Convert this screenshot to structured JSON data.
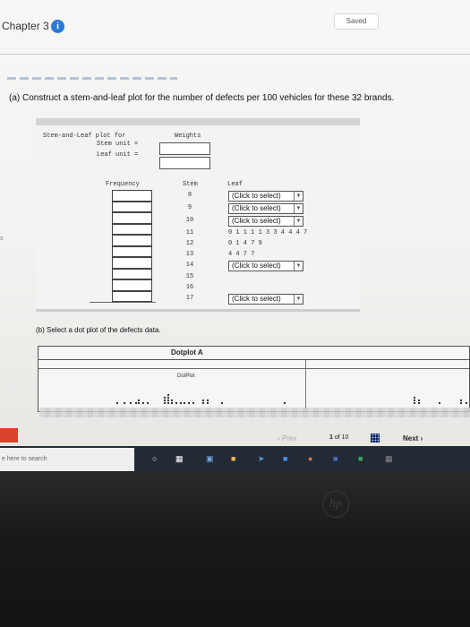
{
  "header": {
    "chapter_label": "Chapter 3",
    "info_glyph": "i",
    "saved_label": "Saved"
  },
  "part_a": {
    "prompt": "(a) Construct a stem-and-leaf plot for the number of defects per 100 vehicles for these 32 brands.",
    "title_label": "Stem-and-Leaf plot for",
    "stem_unit_label": "Stem unit =",
    "leaf_unit_label": "Leaf unit =",
    "weights_label": "Weights",
    "headers": {
      "frequency": "Frequency",
      "stem": "Stem",
      "leaf": "Leaf"
    },
    "rows": [
      {
        "stem": "8",
        "leaf": "(Click to select)",
        "is_select": true
      },
      {
        "stem": "9",
        "leaf": "(Click to select)",
        "is_select": true
      },
      {
        "stem": "10",
        "leaf": "(Click to select)",
        "is_select": true
      },
      {
        "stem": "11",
        "leaf": "0 1 1 1 1 3 3 4 4 4 7",
        "is_select": false
      },
      {
        "stem": "12",
        "leaf": "0 1 4 7 9",
        "is_select": false
      },
      {
        "stem": "13",
        "leaf": "4 4 7 7",
        "is_select": false
      },
      {
        "stem": "14",
        "leaf": "(Click to select)",
        "is_select": true
      },
      {
        "stem": "15",
        "leaf": "",
        "is_select": false
      },
      {
        "stem": "16",
        "leaf": "",
        "is_select": false
      },
      {
        "stem": "17",
        "leaf": "(Click to select)",
        "is_select": true
      }
    ]
  },
  "part_b": {
    "prompt": "(b) Select a dot plot of the defects data.",
    "panel_label": "Dotplot A",
    "plot_title": "DotPlot"
  },
  "nav": {
    "prev_label": "Prev",
    "page_current": "1",
    "page_of": "of",
    "page_total": "10",
    "next_label": "Next"
  },
  "taskbar": {
    "search_placeholder": "e here to search"
  },
  "colors": {
    "accent_blue": "#2a7ad6",
    "panel_grey": "#d4d4d4",
    "taskbar": "#232a36"
  }
}
